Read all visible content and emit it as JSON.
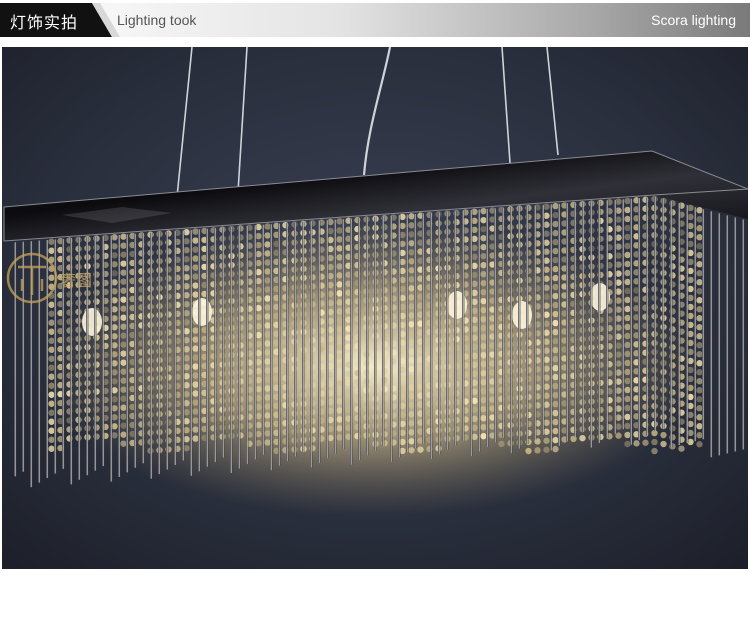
{
  "header": {
    "tab_label": "灯饰实拍",
    "subtitle": "Lighting took",
    "brand": "Scora lighting"
  },
  "photo": {
    "subject": "chandelier",
    "watermark_text": "奢图"
  },
  "colors": {
    "tab_black": "#111111",
    "banner_gray": "#7a7a7a",
    "backdrop": "#2a2f3d",
    "canopy": "#0f0f12",
    "crystal_glow": "#f3dfae",
    "watermark_gold": "#c7a45a"
  }
}
